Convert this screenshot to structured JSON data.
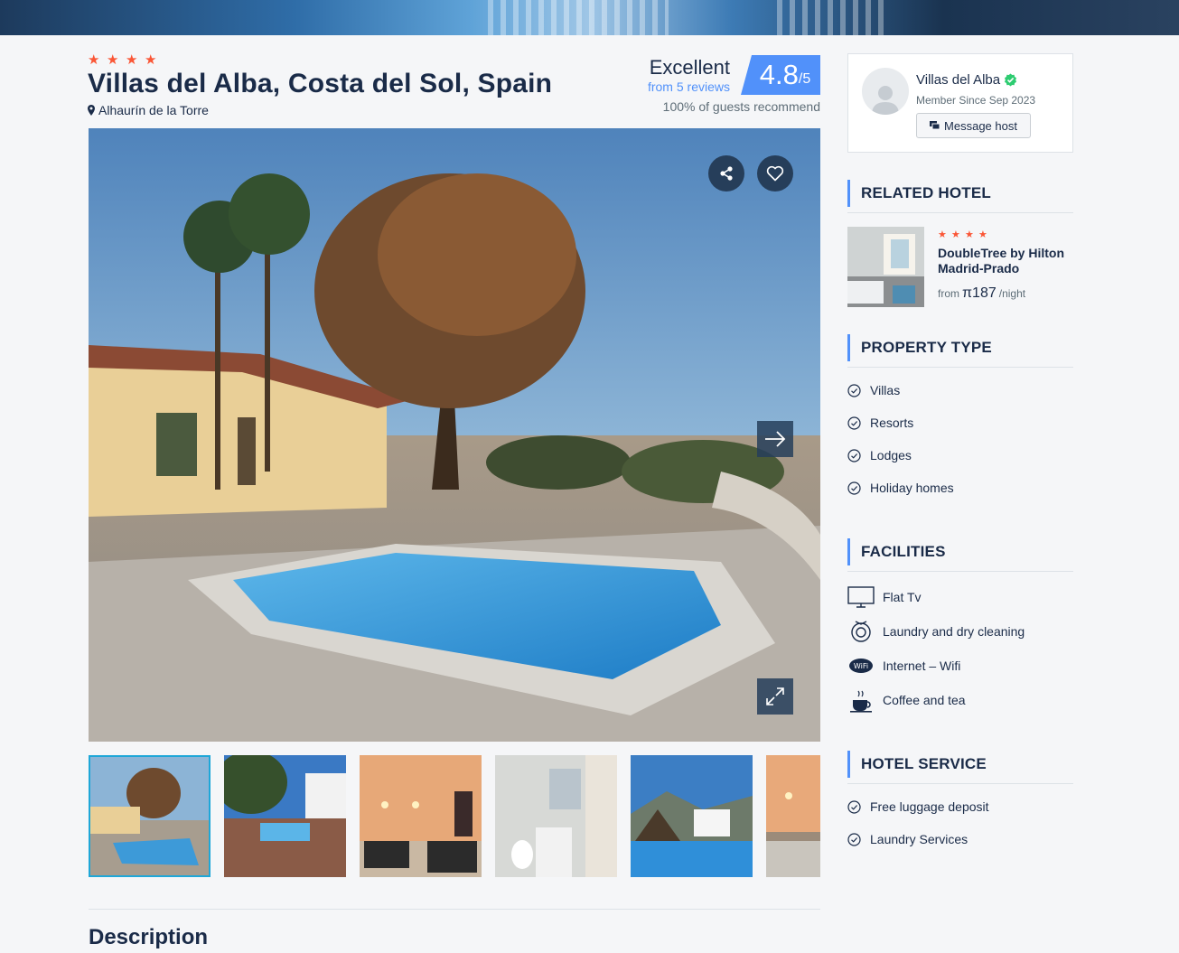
{
  "hotel": {
    "stars": 4,
    "title": "Villas del Alba, Costa del Sol, Spain",
    "location": "Alhaurín de la Torre"
  },
  "review": {
    "rating_word": "Excellent",
    "reviews_link": "from 5 reviews",
    "score": "4.8",
    "score_max": "/5",
    "recommend": "100% of guests recommend"
  },
  "gallery": {
    "share_icon": "share-icon",
    "wishlist_icon": "heart-icon",
    "next_icon": "arrow-right-icon",
    "fullscreen_icon": "expand-icon",
    "thumbnails": [
      "pool-villa",
      "terrace-pool",
      "twin-bedroom",
      "bathroom",
      "pool-view",
      "bedroom-2"
    ],
    "active_thumbnail": 1
  },
  "description": {
    "heading": "Description"
  },
  "owner": {
    "name": "Villas del Alba",
    "verified_icon": "verified-check-icon",
    "member_since": "Member Since Sep 2023",
    "message_label": "Message host"
  },
  "related": {
    "heading": "RELATED HOTEL",
    "stars": 4,
    "name": "DoubleTree by Hilton Madrid-Prado",
    "from_label": "from",
    "price": "π187",
    "per": "/night"
  },
  "property_type": {
    "heading": "PROPERTY TYPE",
    "items": [
      "Villas",
      "Resorts",
      "Lodges",
      "Holiday homes"
    ]
  },
  "facilities": {
    "heading": "FACILITIES",
    "items": [
      {
        "label": "Flat Tv",
        "icon": "tv-icon"
      },
      {
        "label": "Laundry and dry cleaning",
        "icon": "laundry-icon"
      },
      {
        "label": "Internet – Wifi",
        "icon": "wifi-icon"
      },
      {
        "label": "Coffee and tea",
        "icon": "coffee-icon"
      }
    ]
  },
  "hotel_service": {
    "heading": "HOTEL SERVICE",
    "items": [
      "Free luggage deposit",
      "Laundry Services"
    ]
  },
  "colors": {
    "accent": "#5191fa",
    "star": "#fa5636",
    "text": "#1a2b48",
    "verified": "#2ecc71"
  }
}
